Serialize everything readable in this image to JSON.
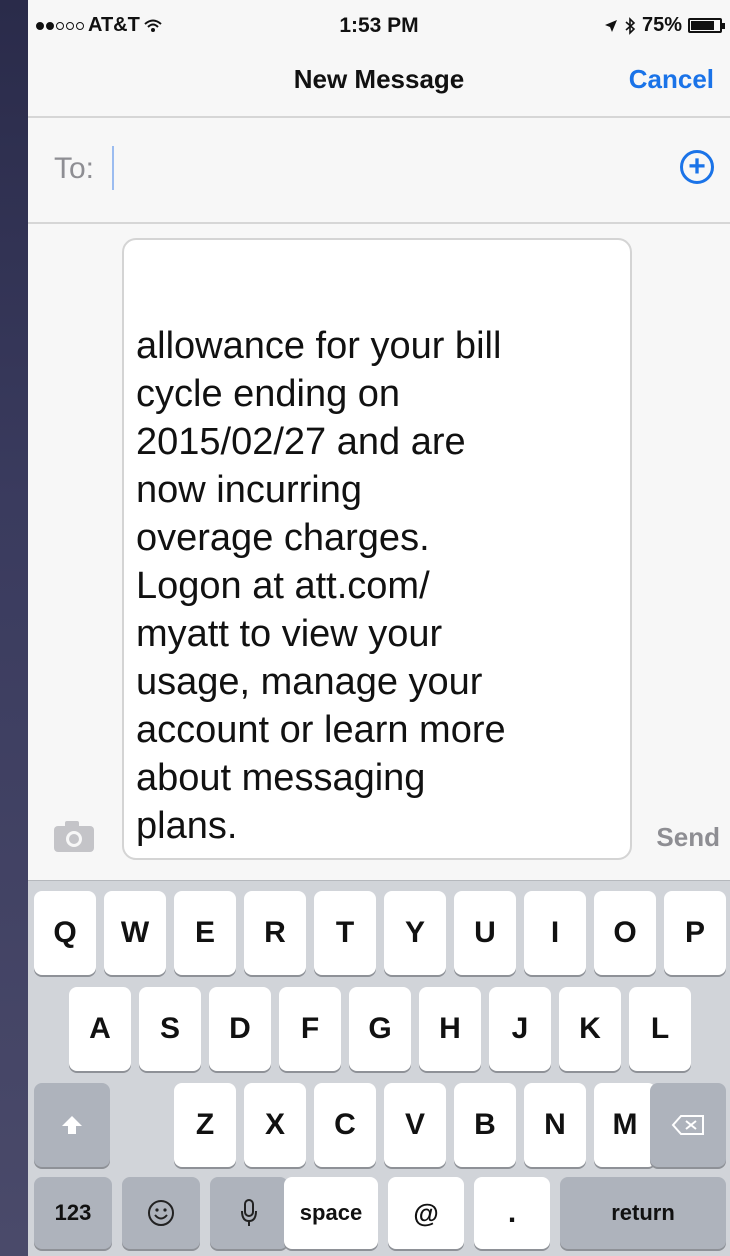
{
  "status_bar": {
    "carrier": "AT&T",
    "time": "1:53 PM",
    "battery": "75%",
    "battery_level": 0.75,
    "signal_bars_filled": 2,
    "signal_bars_total": 5
  },
  "nav": {
    "title": "New Message",
    "cancel_label": "Cancel"
  },
  "recipient": {
    "label": "To:",
    "value": "",
    "add_icon": "plus-circle-icon"
  },
  "message": {
    "text": "allowance for your bill\ncycle ending on\n2015/02/27 and are\nnow incurring\noverage charges.\nLogon at att.com/\nmyatt to view your\nusage, manage your\naccount or learn more\nabout messaging\nplans."
  },
  "compose": {
    "camera_icon": "camera-icon",
    "send_label": "Send"
  },
  "keyboard": {
    "row1": [
      "Q",
      "W",
      "E",
      "R",
      "T",
      "Y",
      "U",
      "I",
      "O",
      "P"
    ],
    "row2": [
      "A",
      "S",
      "D",
      "F",
      "G",
      "H",
      "J",
      "K",
      "L"
    ],
    "row3": [
      "Z",
      "X",
      "C",
      "V",
      "B",
      "N",
      "M"
    ],
    "shift_icon": "shift-icon",
    "delete_icon": "delete-icon",
    "numbers_label": "123",
    "emoji_icon": "emoji-icon",
    "mic_icon": "microphone-icon",
    "space_label": "space",
    "at_label": "@",
    "dot_label": ".",
    "return_label": "return"
  },
  "colors": {
    "accent": "#1a73e8",
    "placeholder_gray": "#8e8e93",
    "keyboard_bg": "#d1d4d9"
  }
}
